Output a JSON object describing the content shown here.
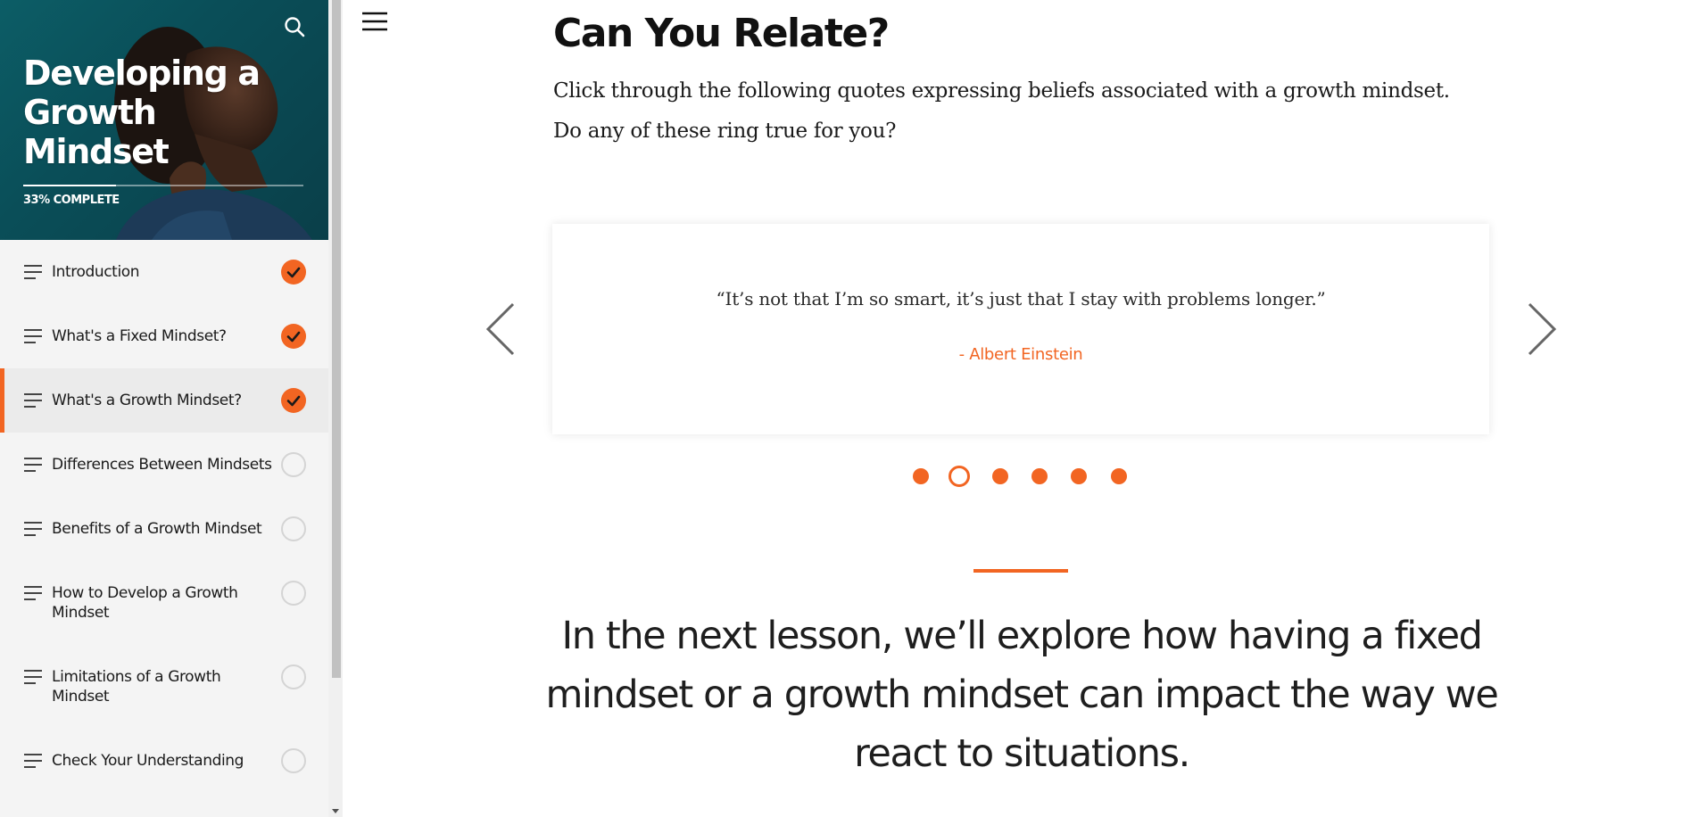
{
  "sidebar": {
    "course_title": "Developing a Growth Mindset",
    "progress_percent": 33,
    "progress_label": "33% COMPLETE",
    "lessons": [
      {
        "label": "Introduction",
        "status": "complete",
        "active": false
      },
      {
        "label": "What's a Fixed Mindset?",
        "status": "complete",
        "active": false
      },
      {
        "label": "What's a Growth Mindset?",
        "status": "complete",
        "active": true
      },
      {
        "label": "Differences Between Mindsets",
        "status": "incomplete",
        "active": false
      },
      {
        "label": "Benefits of a Growth Mindset",
        "status": "incomplete",
        "active": false
      },
      {
        "label": "How to Develop a Growth Mindset",
        "status": "incomplete",
        "active": false
      },
      {
        "label": "Limitations of a Growth Mindset",
        "status": "incomplete",
        "active": false
      },
      {
        "label": "Check Your Understanding",
        "status": "incomplete",
        "active": false
      }
    ]
  },
  "main": {
    "title": "Can You Relate?",
    "intro": "Click through the following quotes expressing beliefs associated with a growth mindset. Do any of these ring true for you?",
    "carousel": {
      "quote": "“It’s not that I’m so smart, it’s just that I stay with problems longer.”",
      "author": "- Albert Einstein",
      "total_slides": 6,
      "current_slide": 2
    },
    "closing": "In the next lesson, we’ll explore how having a fixed mindset or a growth mindset can impact the way we react to situations."
  },
  "colors": {
    "accent": "#f26522",
    "hero_bg": "#0a4e58",
    "sidebar_bg": "#f4f4f4",
    "text": "#1a1a1a"
  },
  "icons": {
    "search": "search-icon",
    "menu": "hamburger-menu-icon",
    "lesson": "lesson-lines-icon",
    "complete": "checkmark-icon",
    "prev": "chevron-left-icon",
    "next": "chevron-right-icon"
  }
}
